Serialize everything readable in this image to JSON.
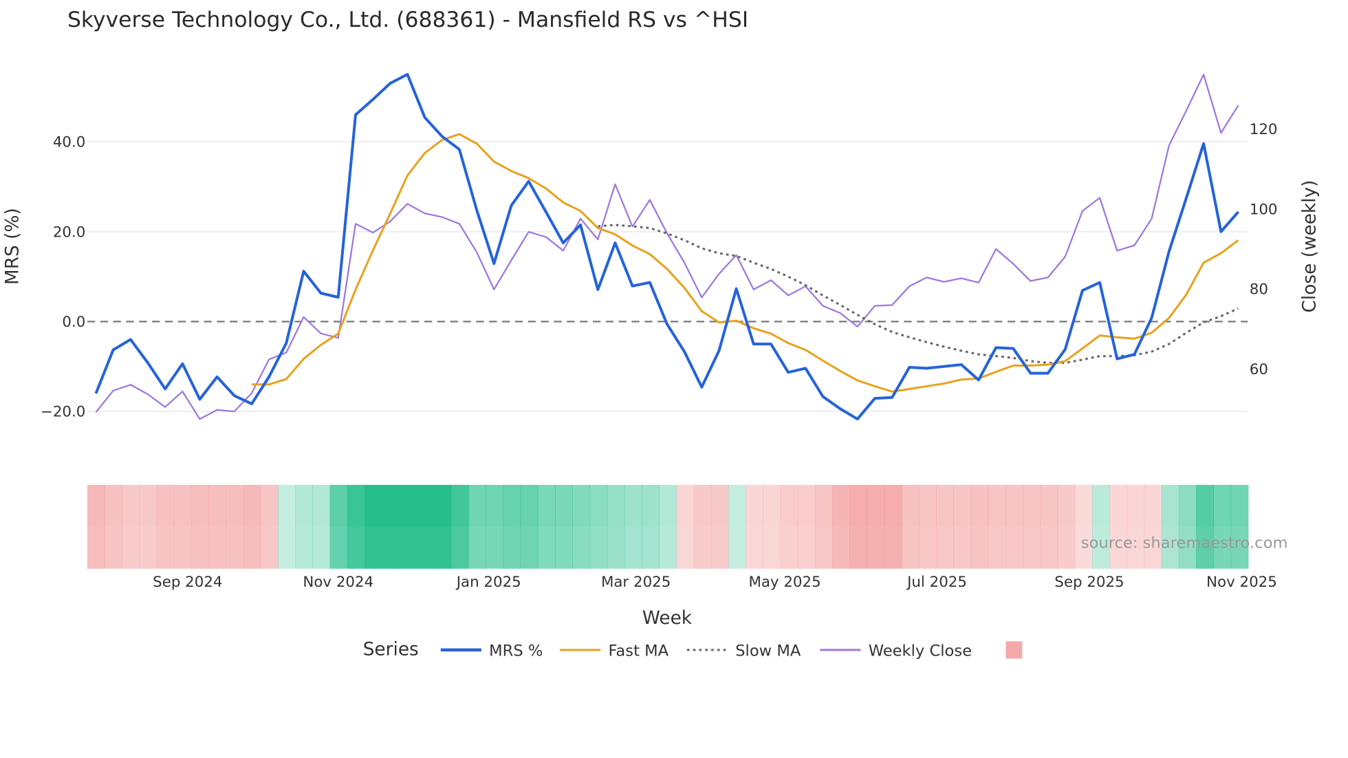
{
  "chart_data": {
    "type": "line",
    "title": "Skyverse Technology Co., Ltd. (688361) - Mansfield RS vs ^HSI",
    "xlabel": "Week",
    "ylabel": "MRS (%)",
    "y2label": "Close (weekly)",
    "ylim": [
      -27,
      56
    ],
    "y2lim": [
      40,
      137
    ],
    "yticks": [
      {
        "v": 40,
        "label": "40.0"
      },
      {
        "v": 20,
        "label": "20.0"
      },
      {
        "v": 0,
        "label": "0.0"
      },
      {
        "v": -20,
        "label": "−20.0"
      }
    ],
    "y2ticks": [
      {
        "v": 120,
        "label": "120"
      },
      {
        "v": 100,
        "label": "100"
      },
      {
        "v": 80,
        "label": "80"
      },
      {
        "v": 60,
        "label": "60"
      }
    ],
    "xticks": [
      {
        "week": 5.3,
        "label": "Sep 2024"
      },
      {
        "week": 14,
        "label": "Nov 2024"
      },
      {
        "week": 22.7,
        "label": "Jan 2025"
      },
      {
        "week": 31.2,
        "label": "Mar 2025"
      },
      {
        "week": 39.8,
        "label": "May 2025"
      },
      {
        "week": 48.6,
        "label": "Jul 2025"
      },
      {
        "week": 57.4,
        "label": "Sep 2025"
      },
      {
        "week": 66.2,
        "label": "Nov 2025"
      }
    ],
    "weeks": 67,
    "series": [
      {
        "name": "MRS %",
        "color": "#2563d9",
        "axis": "y",
        "start": 0,
        "values": [
          -16,
          -6.3,
          -4,
          -9.2,
          -15,
          -9.4,
          -17.3,
          -12.3,
          -16.5,
          -18.3,
          -12.3,
          -4.8,
          11.2,
          6.3,
          5.4,
          46,
          49.4,
          53,
          55,
          45.4,
          41.2,
          38.3,
          24.8,
          12.9,
          25.8,
          31.2,
          24.4,
          17.5,
          21.5,
          7.1,
          17.5,
          7.9,
          8.7,
          -0.6,
          -6.7,
          -14.6,
          -6.5,
          7.3,
          -5,
          -5,
          -11.3,
          -10.4,
          -16.7,
          -19.4,
          -21.7,
          -17.1,
          -16.9,
          -10.2,
          -10.4,
          -10,
          -9.6,
          -13,
          -5.8,
          -6,
          -11.5,
          -11.5,
          -6.2,
          6.9,
          8.7,
          -8.3,
          -7.3,
          0.8,
          15.6,
          27.5,
          39.6,
          20,
          24.4
        ]
      },
      {
        "name": "Fast MA",
        "color": "#e8a21c",
        "axis": "y",
        "start": 9,
        "values": [
          -14,
          -14,
          -12.8,
          -8.3,
          -5.2,
          -2.7,
          7.1,
          15.8,
          24,
          32.5,
          37.5,
          40.4,
          41.7,
          39.6,
          35.6,
          33.5,
          31.9,
          29.6,
          26.5,
          24.6,
          20.8,
          19.4,
          16.9,
          15,
          11.7,
          7.5,
          2.3,
          -0.2,
          0.2,
          -1.5,
          -2.7,
          -4.8,
          -6.3,
          -8.7,
          -11,
          -13.1,
          -14.4,
          -15.6,
          -15,
          -14.4,
          -13.8,
          -12.9,
          -12.7,
          -11.2,
          -9.8,
          -9.8,
          -9.6,
          -8.8,
          -6,
          -3.1,
          -3.5,
          -3.8,
          -2.5,
          0.8,
          6,
          13.1,
          15.2,
          18.1
        ]
      },
      {
        "name": "Slow MA",
        "color": "#666666",
        "axis": "y",
        "dash": true,
        "start": 29,
        "values": [
          21.2,
          21.5,
          21.2,
          20.8,
          19.6,
          18.1,
          16.3,
          15.2,
          14.6,
          13.1,
          11.7,
          10,
          8.1,
          5.8,
          3.7,
          1.5,
          -0.6,
          -2.3,
          -3.5,
          -4.6,
          -5.6,
          -6.5,
          -7.3,
          -7.7,
          -8.1,
          -8.8,
          -9.2,
          -9.2,
          -8.5,
          -7.7,
          -7.7,
          -7.5,
          -6.7,
          -5,
          -2.5,
          -0.2,
          1.2,
          2.9
        ]
      },
      {
        "name": "Weekly Close",
        "color": "#9d78e0",
        "axis": "y2",
        "start": 0,
        "values": [
          49.2,
          54.6,
          56.1,
          53.7,
          50.5,
          54.4,
          47.5,
          49.8,
          49.4,
          54,
          62.4,
          64.1,
          73,
          68.9,
          67.8,
          96.3,
          94.1,
          96.9,
          101.3,
          98.9,
          98,
          96.3,
          89.2,
          79.9,
          87.2,
          94.3,
          93,
          89.6,
          97.6,
          92.4,
          106.2,
          95.6,
          102.3,
          93.9,
          86.6,
          77.9,
          83.8,
          88.5,
          79.9,
          82.2,
          78.4,
          80.7,
          75.8,
          74,
          70.6,
          75.8,
          76,
          80.7,
          82.9,
          81.8,
          82.7,
          81.6,
          90,
          86.3,
          82,
          82.9,
          88.1,
          99.5,
          102.8,
          89.6,
          90.9,
          97.6,
          115.9,
          124.6,
          133.6,
          119,
          125.9
        ]
      }
    ],
    "heatmap_values": [
      -0.55,
      -0.45,
      -0.35,
      -0.35,
      -0.45,
      -0.45,
      -0.5,
      -0.5,
      -0.5,
      -0.55,
      -0.4,
      0.15,
      0.25,
      0.25,
      0.7,
      0.9,
      1,
      1,
      1,
      1,
      1,
      0.85,
      0.6,
      0.6,
      0.65,
      0.65,
      0.55,
      0.55,
      0.5,
      0.45,
      0.4,
      0.35,
      0.35,
      0.25,
      -0.2,
      -0.35,
      -0.35,
      0.15,
      -0.2,
      -0.2,
      -0.3,
      -0.3,
      -0.4,
      -0.6,
      -0.7,
      -0.7,
      -0.7,
      -0.45,
      -0.4,
      -0.4,
      -0.4,
      -0.45,
      -0.4,
      -0.4,
      -0.4,
      -0.4,
      -0.35,
      -0.15,
      0.2,
      -0.2,
      -0.2,
      -0.2,
      0.3,
      0.45,
      0.75,
      0.6,
      0.6
    ],
    "legend": {
      "title": "Series",
      "placement": "bottom"
    },
    "source": "source: sharemaestro.com"
  }
}
